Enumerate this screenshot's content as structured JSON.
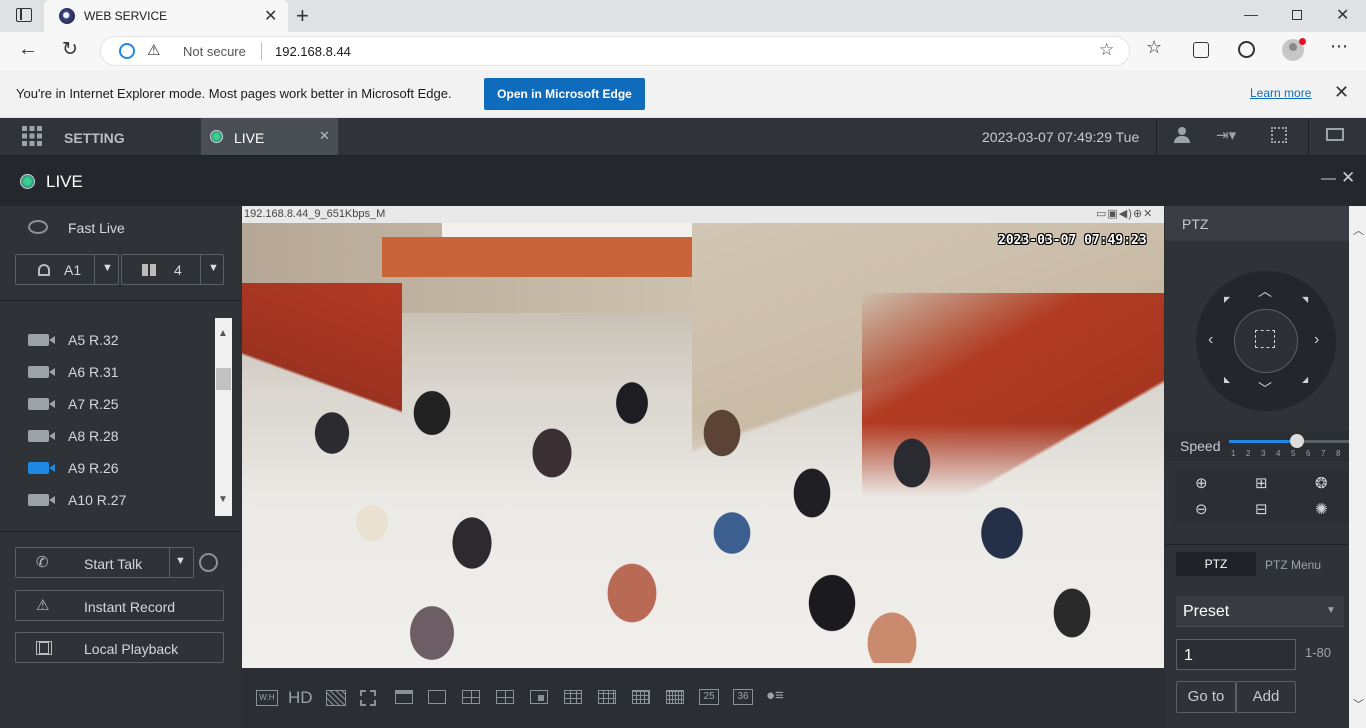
{
  "browser": {
    "tab_title": "WEB SERVICE",
    "security": "Not secure",
    "url": "192.168.8.44",
    "ie_notice": "You're in Internet Explorer mode. Most pages work better in Microsoft Edge.",
    "open_edge": "Open in Microsoft Edge",
    "learn_more": "Learn more"
  },
  "app": {
    "setting_tab": "SETTING",
    "live_tab": "LIVE",
    "datetime": "2023-03-07 07:49:29 Tue",
    "panel_title": "LIVE"
  },
  "left": {
    "fast_live": "Fast Live",
    "group_label": "A1",
    "layout_count": "4",
    "cameras": [
      {
        "label": "A5 R.32",
        "active": false
      },
      {
        "label": "A6 R.31",
        "active": false
      },
      {
        "label": "A7 R.25",
        "active": false
      },
      {
        "label": "A8 R.28",
        "active": false
      },
      {
        "label": "A9 R.26",
        "active": true
      },
      {
        "label": "A10 R.27",
        "active": false
      }
    ],
    "start_talk": "Start Talk",
    "instant_record": "Instant Record",
    "local_playback": "Local Playback"
  },
  "video": {
    "stream_info": "192.168.8.44_9_651Kbps_M",
    "osd_time": "2023-03-07  07:49:23"
  },
  "toolbar": {
    "hd": "HD",
    "wh": "W:H",
    "grid25": "25",
    "grid36": "36"
  },
  "ptz": {
    "title": "PTZ",
    "speed_label": "Speed",
    "speed_ticks": [
      "1",
      "2",
      "3",
      "4",
      "5",
      "6",
      "7",
      "8"
    ],
    "speed_value": 5,
    "tab_ptz": "PTZ",
    "tab_menu": "PTZ Menu",
    "preset_label": "Preset",
    "preset_value": "1",
    "preset_range": "1-80",
    "goto": "Go to",
    "add": "Add"
  },
  "colors": {
    "accent": "#1e88e5",
    "edge_button": "#0f6cbd",
    "active_camera": "#1e88e5"
  }
}
